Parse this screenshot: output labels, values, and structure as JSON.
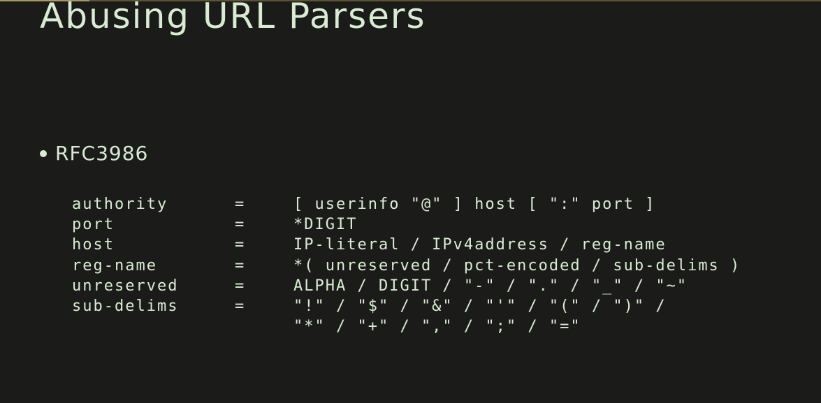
{
  "slide": {
    "title": "Abusing URL Parsers",
    "bullet": "RFC3986"
  },
  "grammar": {
    "rules": [
      {
        "name": "authority",
        "eq": "=",
        "def": "[ userinfo \"@\" ] host [ \":\" port ]"
      },
      {
        "name": "port",
        "eq": "=",
        "def": "*DIGIT"
      },
      {
        "name": "host",
        "eq": "=",
        "def": "IP-literal / IPv4address / reg-name"
      },
      {
        "name": "reg-name",
        "eq": "=",
        "def": "*( unreserved / pct-encoded / sub-delims )"
      },
      {
        "name": "unreserved",
        "eq": "=",
        "def": "ALPHA / DIGIT / \"-\" / \".\" / \"_\" / \"~\""
      },
      {
        "name": "sub-delims",
        "eq": "=",
        "def": "\"!\" / \"$\" / \"&\" / \"'\" / \"(\" / \")\" /"
      },
      {
        "name": "",
        "eq": "",
        "def": "\"*\" / \"+\" / \",\" / \";\" / \"=\""
      }
    ]
  },
  "colors": {
    "background": "#1b1c1a",
    "text": "#d9ecd3",
    "accent_rule": "#a89a63"
  }
}
